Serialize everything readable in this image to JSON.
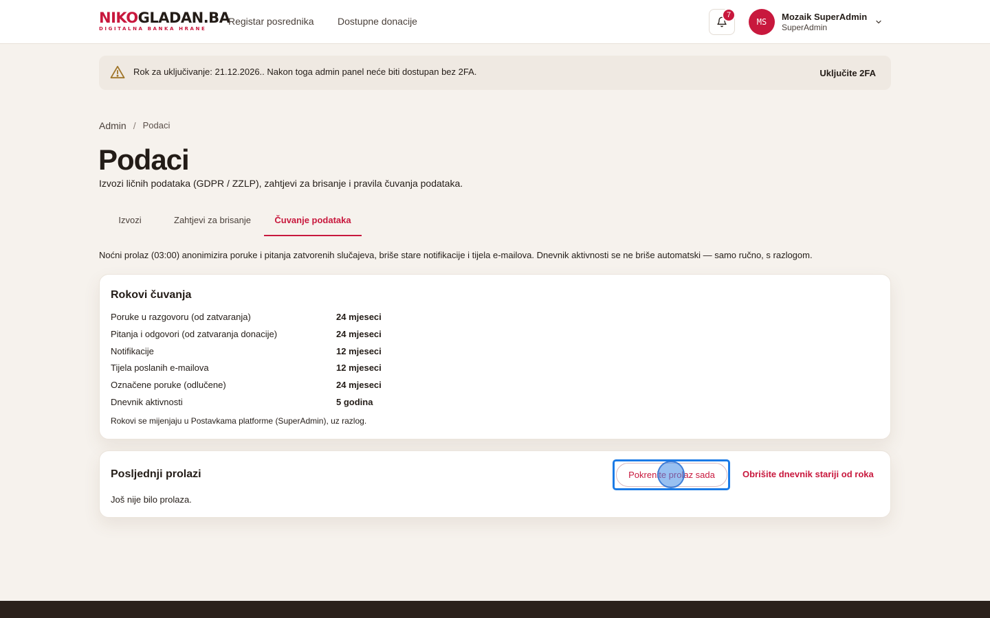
{
  "brand": {
    "logo_part1": "NIKO",
    "logo_part2": "GLADAN.BA",
    "tagline": "DIGITALNA BANKA HRANE"
  },
  "nav": {
    "item1": "Registar posrednika",
    "item2": "Dostupne donacije"
  },
  "notifications": {
    "count": "7"
  },
  "user": {
    "initials": "MS",
    "name": "Mozaik SuperAdmin",
    "role": "SuperAdmin"
  },
  "alert": {
    "text": "Rok za uključivanje: 21.12.2026.. Nakon toga admin panel neće biti dostupan bez 2FA.",
    "action": "Uključite 2FA"
  },
  "breadcrumb": {
    "root": "Admin",
    "separator": "/",
    "current": "Podaci"
  },
  "page": {
    "title": "Podaci",
    "subtitle": "Izvozi ličnih podataka (GDPR / ZZLP), zahtjevi za brisanje i pravila čuvanja podataka."
  },
  "tabs": [
    {
      "label": "Izvozi",
      "active": false
    },
    {
      "label": "Zahtjevi za brisanje",
      "active": false
    },
    {
      "label": "Čuvanje podataka",
      "active": true
    }
  ],
  "intro": "Noćni prolaz (03:00) anonimizira poruke i pitanja zatvorenih slučajeva, briše stare notifikacije i tijela e-mailova. Dnevnik aktivnosti se ne briše automatski — samo ručno, s razlogom.",
  "retention": {
    "title": "Rokovi čuvanja",
    "rows": [
      {
        "label": "Poruke u razgovoru (od zatvaranja)",
        "value": "24 mjeseci"
      },
      {
        "label": "Pitanja i odgovori (od zatvaranja donacije)",
        "value": "24 mjeseci"
      },
      {
        "label": "Notifikacije",
        "value": "12 mjeseci"
      },
      {
        "label": "Tijela poslanih e-mailova",
        "value": "12 mjeseci"
      },
      {
        "label": "Označene poruke (odlučene)",
        "value": "24 mjeseci"
      },
      {
        "label": "Dnevnik aktivnosti",
        "value": "5 godina"
      }
    ],
    "note": "Rokovi se mijenjaju u Postavkama platforme (SuperAdmin), uz razlog."
  },
  "runs": {
    "title": "Posljednji prolazi",
    "run_button": "Pokrenite prolaz sada",
    "delete_button": "Obrišite dnevnik stariji od roka",
    "empty": "Još nije bilo prolaza."
  },
  "colors": {
    "accent": "#c8183d",
    "background": "#f6f2ed",
    "focus": "#1c7be6",
    "footer": "#2b211b"
  }
}
